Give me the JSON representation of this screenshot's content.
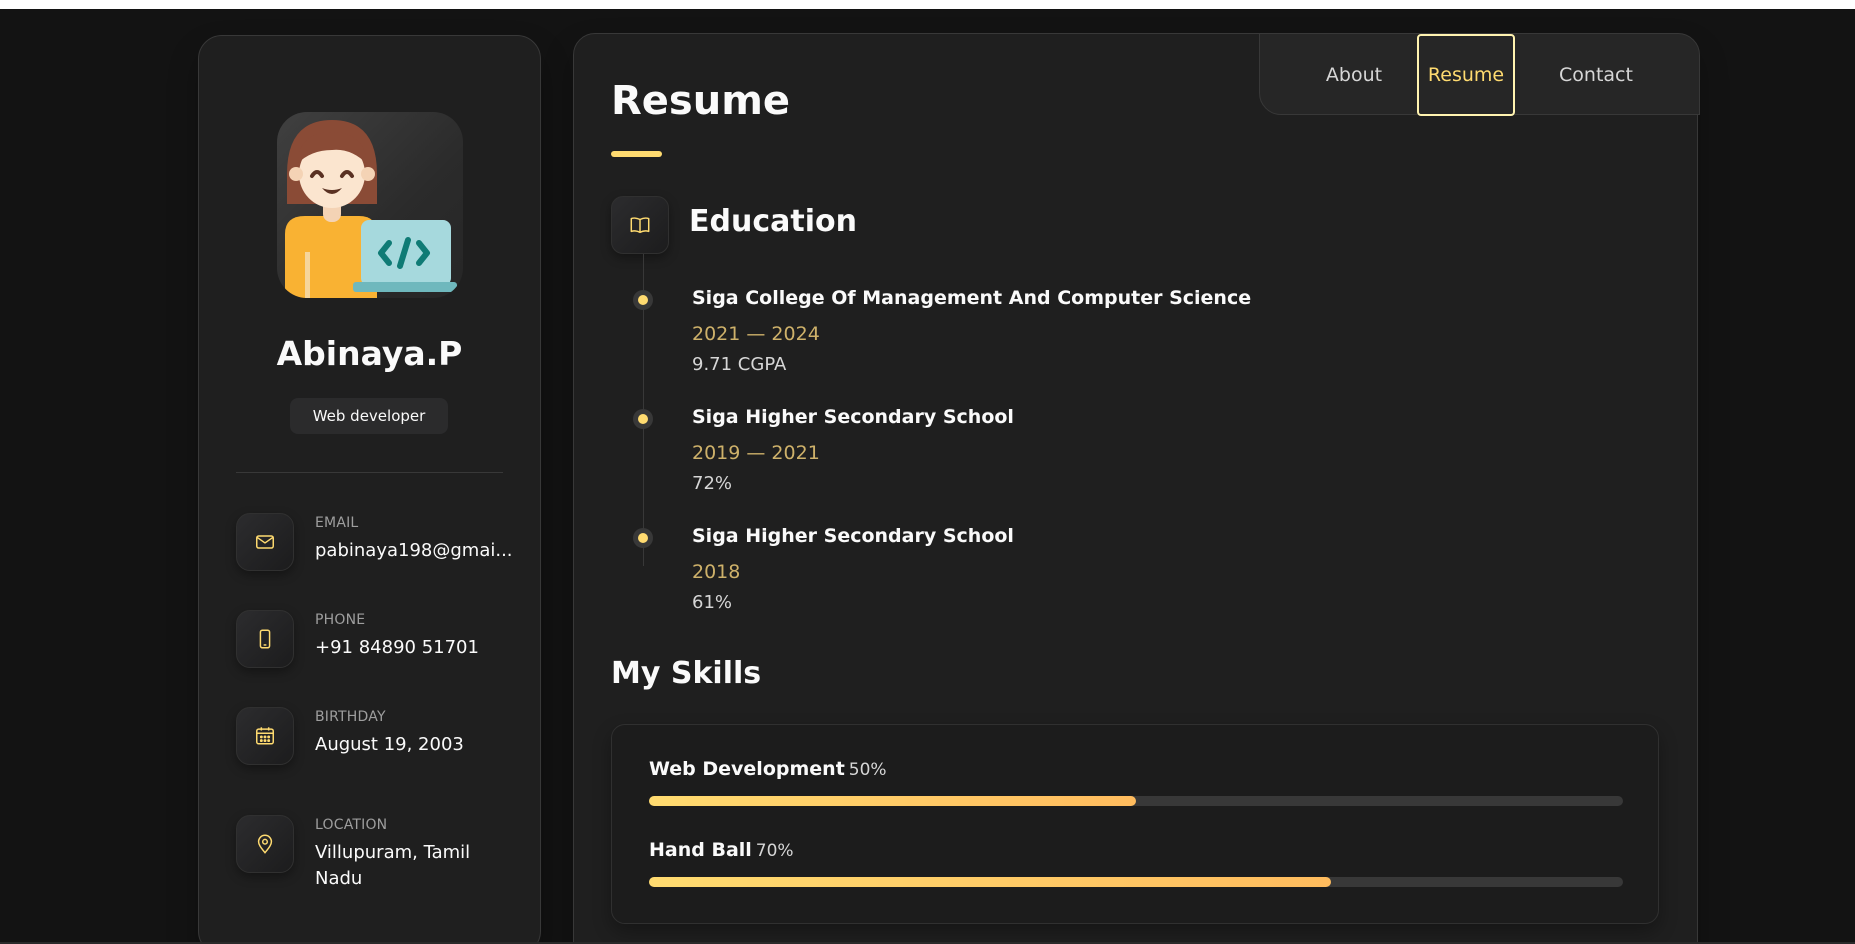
{
  "profile": {
    "name": "Abinaya.P",
    "title": "Web developer",
    "avatar_icon": "developer-avatar-icon"
  },
  "contacts": [
    {
      "icon": "mail-icon",
      "label": "EMAIL",
      "value": "pabinaya198@gmai..."
    },
    {
      "icon": "phone-icon",
      "label": "PHONE",
      "value": "+91 84890 51701"
    },
    {
      "icon": "calendar-icon",
      "label": "BIRTHDAY",
      "value": "August 19, 2003"
    },
    {
      "icon": "location-pin-icon",
      "label": "LOCATION",
      "value": "Villupuram, Tamil Nadu"
    }
  ],
  "nav": {
    "items": [
      "About",
      "Resume",
      "Contact"
    ],
    "active": "Resume"
  },
  "page": {
    "title": "Resume"
  },
  "education": {
    "title": "Education",
    "icon": "book-open-icon",
    "items": [
      {
        "title": "Siga College Of Management And Computer Science",
        "date": "2021 — 2024",
        "text": "9.71 CGPA"
      },
      {
        "title": "Siga Higher Secondary School",
        "date": "2019 — 2021",
        "text": "72%"
      },
      {
        "title": "Siga Higher Secondary School",
        "date": "2018",
        "text": "61%"
      }
    ]
  },
  "skills": {
    "title": "My Skills",
    "items": [
      {
        "name": "Web Development",
        "percent_label": "50%",
        "value": 50
      },
      {
        "name": "Hand Ball",
        "percent_label": "70%",
        "value": 70
      }
    ]
  },
  "colors": {
    "accent": "#ffdb70",
    "background": "#131313",
    "card": "#1f1f1f",
    "date_text": "#ceb16a"
  }
}
